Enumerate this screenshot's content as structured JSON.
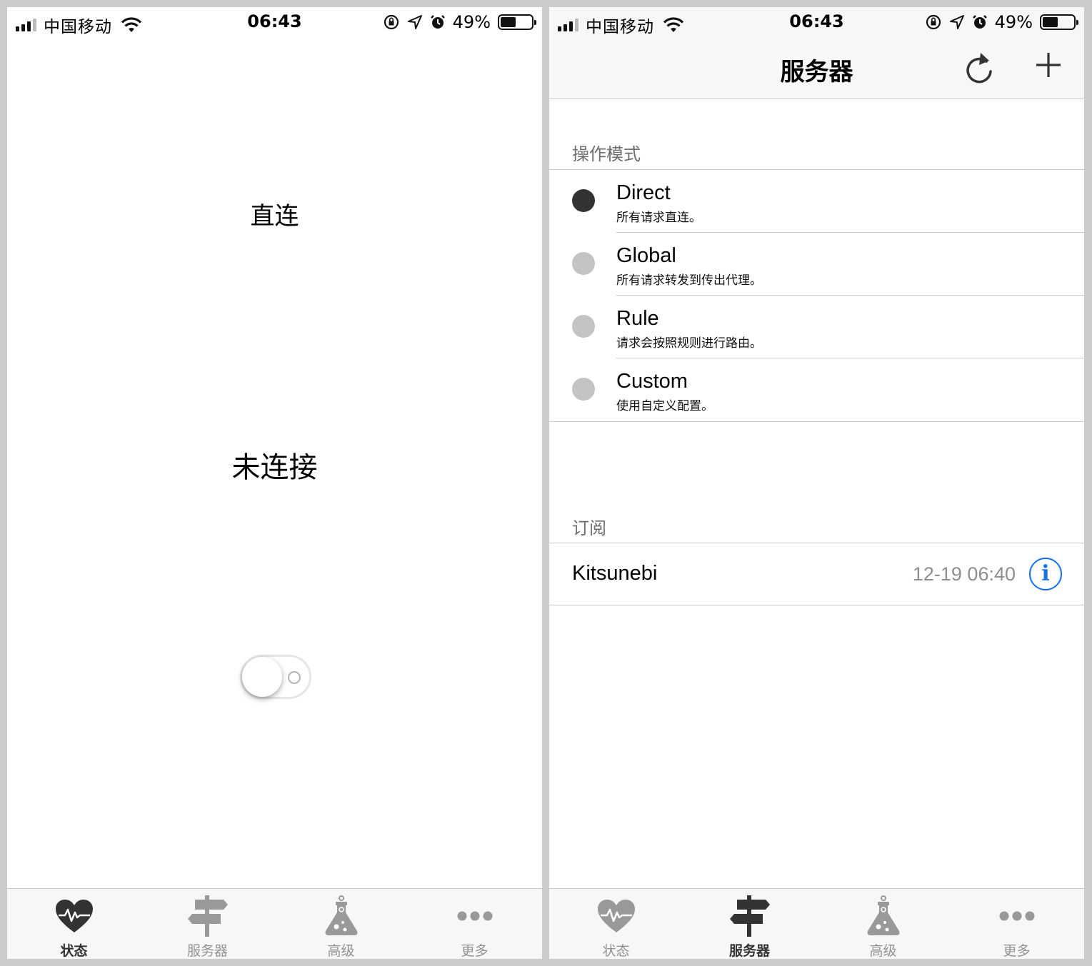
{
  "status_bar": {
    "carrier": "中国移动",
    "time": "06:43",
    "battery": "49%",
    "battery_level": 0.49
  },
  "left_screen": {
    "mode": "直连",
    "connection_status": "未连接",
    "vpn_toggle_on": false
  },
  "right_screen": {
    "title": "服务器",
    "mode_section_header": "操作模式",
    "modes": [
      {
        "name": "Direct",
        "description": "所有请求直连。",
        "selected": true
      },
      {
        "name": "Global",
        "description": "所有请求转发到传出代理。",
        "selected": false
      },
      {
        "name": "Rule",
        "description": "请求会按照规则进行路由。",
        "selected": false
      },
      {
        "name": "Custom",
        "description": "使用自定义配置。",
        "selected": false
      }
    ],
    "subscription_section_header": "订阅",
    "subscription": {
      "name": "Kitsunebi",
      "updated": "12-19 06:40"
    }
  },
  "tabbar": {
    "tabs": [
      {
        "label": "状态",
        "icon": "heart-pulse-icon"
      },
      {
        "label": "服务器",
        "icon": "signpost-icon"
      },
      {
        "label": "高级",
        "icon": "flask-icon"
      },
      {
        "label": "更多",
        "icon": "more-dots-icon"
      }
    ]
  },
  "colors": {
    "active_tab": "#333333",
    "inactive_tab": "#929292",
    "info_accent": "#1a73e8",
    "radio_on": "#333333",
    "radio_off": "#c4c4c4"
  }
}
